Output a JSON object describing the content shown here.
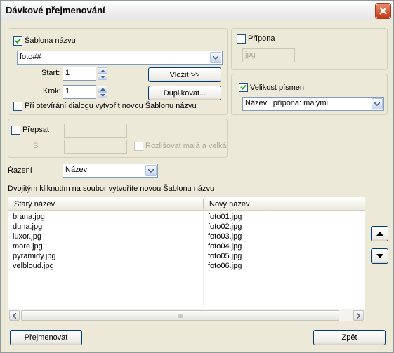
{
  "window": {
    "title": "Dávkové přejmenování"
  },
  "template": {
    "checkbox_label": "Šablona názvu",
    "checked": true,
    "value": "foto##",
    "start_label": "Start:",
    "start_value": "1",
    "step_label": "Krok:",
    "step_value": "1",
    "insert_button": "Vložit >>",
    "duplicate_button": "Duplikovat...",
    "new_on_open_label": "Při otevírání dialogu vytvořit novou Šablonu názvu",
    "new_on_open_checked": false
  },
  "extension": {
    "checkbox_label": "Přípona",
    "checked": false,
    "value": "jpg"
  },
  "case": {
    "checkbox_label": "Velikost písmen",
    "checked": true,
    "selected": "Název i přípona: malými"
  },
  "overwrite": {
    "checkbox_label": "Přepsat",
    "checked": false,
    "with_label": "S",
    "case_sensitive_label": "Rozlišovat malá a velká"
  },
  "sort": {
    "label": "Řazení",
    "selected": "Název"
  },
  "hint": "Dvojitým kliknutím na soubor vytvoříte novou Šablonu názvu",
  "list": {
    "columns": [
      "Starý název",
      "Nový název"
    ],
    "rows": [
      [
        "brana.jpg",
        "foto01.jpg"
      ],
      [
        "duna.jpg",
        "foto02.jpg"
      ],
      [
        "luxor.jpg",
        "foto03.jpg"
      ],
      [
        "more.jpg",
        "foto04.jpg"
      ],
      [
        "pyramidy.jpg",
        "foto05.jpg"
      ],
      [
        "velbloud.jpg",
        "foto06.jpg"
      ]
    ]
  },
  "buttons": {
    "rename": "Přejmenovat",
    "back": "Zpět"
  },
  "icons": {
    "close": "close-icon",
    "combo": "chevron-down-icon",
    "move_up": "triangle-up-icon",
    "move_down": "triangle-down-icon"
  }
}
